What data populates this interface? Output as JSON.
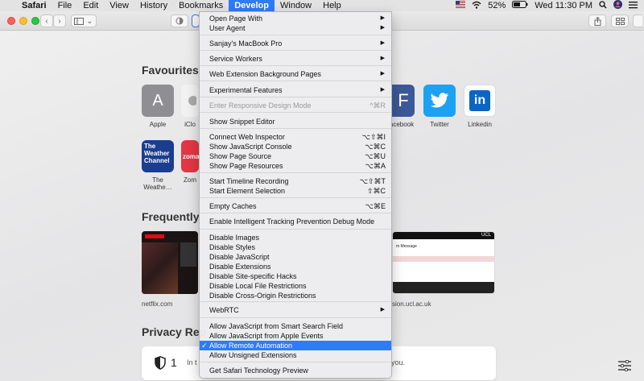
{
  "menubar": {
    "apple_glyph": "",
    "items": [
      "Safari",
      "File",
      "Edit",
      "View",
      "History",
      "Bookmarks",
      "Develop",
      "Window",
      "Help"
    ],
    "active": "Develop",
    "battery": "52%",
    "clock": "Wed 11:30 PM"
  },
  "colors": {
    "accent": "#2f7bf5",
    "close": "#fd5f57",
    "minimize": "#febc2e",
    "zoom": "#28c840"
  },
  "toolbar": {
    "back": "‹",
    "forward": "›",
    "tabs_icon": "sidebar-icon",
    "chevron": "⌄"
  },
  "page": {
    "favourites_title": "Favourites",
    "favourites": [
      {
        "label": "Apple",
        "glyph": "A",
        "color": "#8e8e93"
      },
      {
        "label": "iCloud",
        "glyph": "",
        "color": "#f2f2f2"
      },
      {
        "label": "Facebook",
        "glyph": "F",
        "color": "#3b5998"
      },
      {
        "label": "Twitter",
        "glyph": "🐦",
        "color": "#1da1f2"
      },
      {
        "label": "Linkedin",
        "glyph": "in",
        "color": "#ffffff"
      }
    ],
    "fav_row2": [
      {
        "label": "The Weathe…",
        "glyph": "The Weather Channel",
        "color": "#1a3d8f"
      },
      {
        "label": "Zom…",
        "glyph": "zomato",
        "color": "#e23744"
      }
    ],
    "apple_label": "Apple",
    "icloud_label": "iClo",
    "facebook_label": "acebook",
    "twitter_label": "Twitter",
    "linkedin_label": "Linkedin",
    "weather_label_1": "The",
    "weather_label_2": "Weathe…",
    "zomato_label": "Zom",
    "frequently_title": "Frequently",
    "netflix_label": "netflix.com",
    "ucl_label": "sion.ucl.ac.uk",
    "ucl_thumb_header": "UCL",
    "ucl_thumb_title": "m Message",
    "privacy_title": "Privacy Rep",
    "privacy_count": "1",
    "privacy_prefix": "In t",
    "privacy_suffix": "you."
  },
  "develop_menu": {
    "items": [
      {
        "label": "Open Page With",
        "submenu": true
      },
      {
        "label": "User Agent",
        "submenu": true
      },
      {
        "label": "Sanjay's MacBook Pro",
        "submenu": true
      },
      {
        "label": "Service Workers",
        "submenu": true
      },
      {
        "label": "Web Extension Background Pages",
        "submenu": true
      },
      {
        "label": "Experimental Features",
        "submenu": true
      },
      {
        "label": "Enter Responsive Design Mode",
        "shortcut": "^⌘R",
        "disabled": true
      },
      {
        "label": "Show Snippet Editor"
      },
      {
        "label": "Connect Web Inspector",
        "shortcut": "⌥⇧⌘I"
      },
      {
        "label": "Show JavaScript Console",
        "shortcut": "⌥⌘C"
      },
      {
        "label": "Show Page Source",
        "shortcut": "⌥⌘U"
      },
      {
        "label": "Show Page Resources",
        "shortcut": "⌥⌘A"
      },
      {
        "label": "Start Timeline Recording",
        "shortcut": "⌥⇧⌘T"
      },
      {
        "label": "Start Element Selection",
        "shortcut": "⇧⌘C"
      },
      {
        "label": "Empty Caches",
        "shortcut": "⌥⌘E"
      },
      {
        "label": "Enable Intelligent Tracking Prevention Debug Mode"
      },
      {
        "label": "Disable Images"
      },
      {
        "label": "Disable Styles"
      },
      {
        "label": "Disable JavaScript"
      },
      {
        "label": "Disable Extensions"
      },
      {
        "label": "Disable Site-specific Hacks"
      },
      {
        "label": "Disable Local File Restrictions"
      },
      {
        "label": "Disable Cross-Origin Restrictions"
      },
      {
        "label": "WebRTC",
        "submenu": true
      },
      {
        "label": "Allow JavaScript from Smart Search Field"
      },
      {
        "label": "Allow JavaScript from Apple Events"
      },
      {
        "label": "Allow Remote Automation",
        "checked": true
      },
      {
        "label": "Allow Unsigned Extensions"
      },
      {
        "label": "Get Safari Technology Preview"
      }
    ]
  }
}
